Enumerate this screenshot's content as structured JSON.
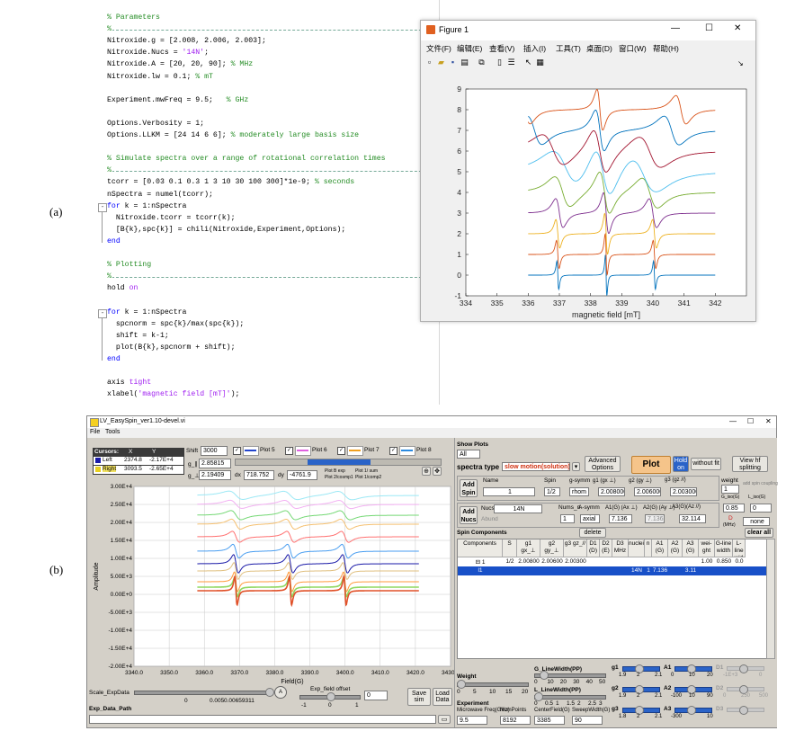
{
  "panel_labels": {
    "a": "(a)",
    "b": "(b)"
  },
  "code_lines": [
    {
      "text": "% Parameters",
      "style": "cm"
    },
    {
      "text": "%",
      "style": "sep"
    },
    {
      "text": "Nitroxide.g = [2.008, 2.006, 2.003];",
      "style": ""
    },
    {
      "text": "Nitroxide.Nucs = ",
      "str": "'14N'",
      "after": ";",
      "style": ""
    },
    {
      "text": "Nitroxide.A = [20, 20, 90];",
      "cmt": " % MHz",
      "style": ""
    },
    {
      "text": "Nitroxide.lw = 0.1;",
      "cmt": " % mT",
      "style": ""
    },
    {
      "text": "",
      "style": ""
    },
    {
      "text": "Experiment.mwFreq = 9.5;",
      "cmt": "   % GHz",
      "style": ""
    },
    {
      "text": "",
      "style": ""
    },
    {
      "text": "Options.Verbosity = 1;",
      "style": ""
    },
    {
      "text": "Options.LLKM = [24 14 6 6];",
      "cmt": " % moderately large basis size",
      "style": ""
    },
    {
      "text": "",
      "style": ""
    },
    {
      "text": "% Simulate spectra over a range of rotational correlation times",
      "style": "cm"
    },
    {
      "text": "%",
      "style": "sep"
    },
    {
      "text": "tcorr = [0.03 0.1 0.3 1 3 10 30 100 300]*1e-9;",
      "cmt": " % seconds",
      "style": ""
    },
    {
      "text": "nSpectra = numel(tcorr);",
      "style": ""
    },
    {
      "kw": "for",
      "text": " k = 1:nSpectra",
      "style": "",
      "fold": "-"
    },
    {
      "text": "  Nitroxide.tcorr = tcorr(k);",
      "style": ""
    },
    {
      "text": "  [B{k},spc{k}] = chili(Nitroxide,Experiment,Options);",
      "style": ""
    },
    {
      "kw": "end",
      "text": "",
      "style": ""
    },
    {
      "text": "",
      "style": ""
    },
    {
      "text": "% Plotting",
      "style": "cm"
    },
    {
      "text": "%",
      "style": "sep"
    },
    {
      "text": "hold ",
      "str": "on",
      "style": ""
    },
    {
      "text": "",
      "style": ""
    },
    {
      "kw": "for",
      "text": " k = 1:nSpectra",
      "style": "",
      "fold": "-"
    },
    {
      "text": "  spcnorm = spc{k}/max(spc{k});",
      "style": ""
    },
    {
      "text": "  shift = k-1;",
      "style": ""
    },
    {
      "text": "  plot(B{k},spcnorm + shift);",
      "style": ""
    },
    {
      "kw": "end",
      "text": "",
      "style": ""
    },
    {
      "text": "",
      "style": ""
    },
    {
      "text": "axis ",
      "str": "tight",
      "style": ""
    },
    {
      "text": "xlabel(",
      "str": "'magnetic field [mT]'",
      "after": ");",
      "style": ""
    }
  ],
  "figure_window": {
    "title": "Figure 1",
    "icon": "matlab-figure-icon",
    "controls": {
      "minimize": "—",
      "maximize": "☐",
      "close": "✕"
    },
    "menu": [
      "文件(F)",
      "编辑(E)",
      "查看(V)",
      "插入(I)",
      "工具(T)",
      "桌面(D)",
      "窗口(W)",
      "帮助(H)"
    ],
    "menu_arrow": "↘"
  },
  "chart_data": [
    {
      "type": "line",
      "title": "",
      "xlabel": "magnetic field [mT]",
      "ylabel": "",
      "xlim": [
        334,
        343
      ],
      "ylim": [
        -1,
        9
      ],
      "x_ticks": [
        334,
        335,
        336,
        337,
        338,
        339,
        340,
        341,
        342
      ],
      "y_ticks": [
        -1,
        0,
        1,
        2,
        3,
        4,
        5,
        6,
        7,
        8,
        9
      ],
      "grid": false,
      "legend": "none",
      "series": [
        {
          "offset": 0,
          "color": "#0072bd",
          "lines": [
            336.95,
            338.5,
            340.05
          ],
          "width": 0.05,
          "rot": 0.0
        },
        {
          "offset": 1,
          "color": "#d95319",
          "lines": [
            336.95,
            338.5,
            340.05
          ],
          "width": 0.07,
          "rot": 0.05
        },
        {
          "offset": 2,
          "color": "#edb120",
          "lines": [
            336.95,
            338.5,
            340.05
          ],
          "width": 0.1,
          "rot": 0.15
        },
        {
          "offset": 3,
          "color": "#7e2f8e",
          "lines": [
            337.0,
            338.5,
            340.0
          ],
          "width": 0.18,
          "rot": 0.35
        },
        {
          "offset": 4,
          "color": "#77ac30",
          "lines": [
            337.1,
            338.45,
            339.9
          ],
          "width": 0.35,
          "rot": 0.6
        },
        {
          "offset": 5,
          "color": "#4dbeee",
          "lines": [
            337.2,
            338.4,
            339.7
          ],
          "width": 0.55,
          "rot": 0.8
        },
        {
          "offset": 6,
          "color": "#a2142f",
          "lines": [
            336.8,
            338.3,
            339.9
          ],
          "width": 0.45,
          "rot": 0.9
        },
        {
          "offset": 7,
          "color": "#0072bd",
          "lines": [
            336.2,
            338.3,
            340.6
          ],
          "width": 0.3,
          "rot": 1.0
        },
        {
          "offset": 8,
          "color": "#d95319",
          "lines": [
            335.9,
            338.3,
            340.9
          ],
          "width": 0.2,
          "rot": 1.0
        }
      ]
    },
    {
      "type": "line",
      "title": "",
      "xlabel": "Field(G)",
      "ylabel": "Amplitude",
      "xlim": [
        3340,
        3430
      ],
      "ylim": [
        -20000,
        30000
      ],
      "x_ticks": [
        "3340.0",
        "3350.0",
        "3360.0",
        "3370.0",
        "3380.0",
        "3390.0",
        "3400.0",
        "3410.0",
        "3420.0",
        "3430.0"
      ],
      "y_ticks": [
        "3.00E+4",
        "2.50E+4",
        "2.00E+4",
        "1.50E+4",
        "1.00E+4",
        "5.00E+3",
        "0.00E+0",
        "-5.00E+3",
        "-1.00E+4",
        "-1.50E+4",
        "-2.00E+4"
      ],
      "grid": true,
      "legend": "none",
      "main_lines": [
        3369.0,
        3384.5,
        3400.0
      ],
      "series": [
        {
          "offset": 27500,
          "color": "#9be8f5",
          "amp": 800,
          "width": 3.5
        },
        {
          "offset": 25000,
          "color": "#f2b0f2",
          "amp": 900,
          "width": 3.0
        },
        {
          "offset": 22000,
          "color": "#74d874",
          "amp": 1200,
          "width": 2.5
        },
        {
          "offset": 19500,
          "color": "#f5c070",
          "amp": 1500,
          "width": 2.2
        },
        {
          "offset": 16000,
          "color": "#ff7070",
          "amp": 2000,
          "width": 1.8
        },
        {
          "offset": 12000,
          "color": "#4a9ef0",
          "amp": 3000,
          "width": 1.5
        },
        {
          "offset": 8500,
          "color": "#1a1aa8",
          "amp": 5000,
          "width": 1.2
        },
        {
          "offset": 6500,
          "color": "#e0c080",
          "amp": 5500,
          "width": 1.0
        },
        {
          "offset": 3500,
          "color": "#ff9a3a",
          "amp": 8000,
          "width": 0.8
        },
        {
          "offset": 2000,
          "color": "#8fd860",
          "amp": 9000,
          "width": 0.7
        },
        {
          "offset": 1000,
          "color": "#e05028",
          "amp": 17000,
          "width": 0.55
        }
      ]
    }
  ],
  "lv_app": {
    "title": "LV_EasySpin_ver1.10-devel.vi",
    "title_controls": {
      "minimize": "—",
      "maximize": "☐",
      "close": "✕"
    },
    "menu": [
      "File",
      "Tools"
    ],
    "cursors": {
      "header": [
        "Cursors:",
        "X",
        "Y"
      ],
      "rows": [
        {
          "name": "Left",
          "x": "2374.8",
          "y": "-2.17E+4",
          "swatch": "#1a1aa8"
        },
        {
          "name": "Right",
          "x": "3093.5",
          "y": "-2.65E+4",
          "swatch": "#e8d020"
        }
      ]
    },
    "shift": {
      "label": "Shift",
      "value": "3000"
    },
    "g_para": {
      "label": "g_∥",
      "value": "2.85815"
    },
    "g_perp": {
      "label": "g_⊥",
      "value": "2.19409"
    },
    "dx": {
      "label": "dx",
      "value": "718.752"
    },
    "dy": {
      "label": "dy",
      "value": "-4761.9"
    },
    "plot_notes": [
      "Plot B exp",
      "Plot 2/cosmp1",
      "Plot 1/ sum",
      "Plot 1/comp2"
    ],
    "plot_legend": [
      {
        "label": "Plot 5",
        "color": "#2244cc"
      },
      {
        "label": "Plot 6",
        "color": "#e060e0"
      },
      {
        "label": "Plot 7",
        "color": "#f0a020"
      },
      {
        "label": "Plot 8",
        "color": "#2a8ae0"
      }
    ],
    "show_plots": {
      "label": "Show Plots",
      "value": "All"
    },
    "spectra_type": {
      "label": "spectra type",
      "value": "slow motion(solution)"
    },
    "buttons": {
      "advanced": "Advanced Options",
      "plot": "Plot",
      "hold": "Hold on",
      "without_fit": "without fit",
      "view_hf": "View hf splitting",
      "add_spin": "Add Spin",
      "add_nucs": "Add Nucs",
      "delete": "delete",
      "clear_all": "clear all",
      "save_sim": "Save sim",
      "load_data": "Load Data"
    },
    "spin": {
      "headers": [
        "Name",
        "Spin",
        "g-symm",
        "g1 (gx ⊥)",
        "g2 (gy ⊥)",
        "g3 (gz //)",
        "weight"
      ],
      "name": "1",
      "spin": "1/2",
      "gsymm": "rhom",
      "g1": "2.008000",
      "g2": "2.006000",
      "g3": "2.003000",
      "weight": "1"
    },
    "nucs": {
      "headers": [
        "Nucs",
        "Nums_n",
        "A-symm",
        "A1(G) (Ax ⊥)",
        "A2(G) (Ay ⊥)",
        "A3(G)(Az //)"
      ],
      "nucs": "14N",
      "abund": "Abund",
      "nums": "1",
      "asymm": "axial",
      "a1": "7.136",
      "a2": "7.136",
      "a3": "32.114"
    },
    "side_small": {
      "add_spin_coupling": "add spin coupling",
      "g_iso": "G_iso(G)",
      "l_iso": "L_iso(G)",
      "g_val": "0.85",
      "l_val": "0",
      "d_label": "D",
      "d_sub": "(MHz)",
      "none": "none"
    },
    "spin_components": {
      "title": "Spin Components",
      "columns": [
        "Components",
        "S",
        "g1 gx_⊥",
        "g2 gy_⊥",
        "g3 gz_//",
        "D1 (D)",
        "D2 (E)",
        "D3 MHz",
        "nuclei",
        "n",
        "A1 (G)",
        "A2 (G)",
        "A3 (G)",
        "wei-ght",
        "G-line width",
        "L-line wid"
      ],
      "rows": [
        [
          "⊟ 1",
          "1/2",
          "2.00800",
          "2.00600",
          "2.00300",
          "",
          "",
          "",
          "",
          "",
          "",
          "",
          "",
          "1.00",
          "0.850",
          "0.0"
        ],
        [
          "l1",
          "",
          "",
          "",
          "",
          "",
          "",
          "",
          "14N",
          "1",
          "7.136",
          "",
          "3.11",
          "",
          "",
          ""
        ]
      ]
    },
    "sliders": {
      "weight": {
        "label": "Weight",
        "ticks": [
          "0",
          "5",
          "10",
          "15",
          "20"
        ]
      },
      "g_lw": {
        "label": "G_LineWidth(PP)",
        "ticks": [
          "0",
          "10",
          "20",
          "30",
          "40",
          "50"
        ]
      },
      "l_lw": {
        "label": "L_LineWidth(PP)",
        "ticks": [
          "0",
          "0.5",
          "1",
          "1.5",
          "2",
          "2.5",
          "3"
        ]
      },
      "g1": {
        "label": "g1",
        "ticks": [
          "1.9",
          "2",
          "2.1"
        ]
      },
      "g2": {
        "label": "g2",
        "ticks": [
          "1.9",
          "2",
          "2.1"
        ]
      },
      "g3": {
        "label": "g3",
        "ticks": [
          "1.8",
          "2",
          "2.1"
        ]
      },
      "a1": {
        "label": "A1",
        "ticks": [
          "0",
          "10",
          "20"
        ]
      },
      "a2": {
        "label": "A2",
        "ticks": [
          "-100",
          "10",
          "90"
        ]
      },
      "a3": {
        "label": "A3",
        "ticks": [
          "-300",
          "10"
        ]
      },
      "d1": {
        "label": "D1",
        "ticks": [
          "-1E+3",
          "0"
        ]
      },
      "d2": {
        "label": "D2",
        "ticks": [
          "0",
          "250",
          "500"
        ]
      },
      "d3": {
        "label": "D3",
        "ticks": [
          ""
        ]
      }
    },
    "experiment": {
      "label": "Experiment",
      "fields": [
        {
          "label": "Microwave Freq(GHz)",
          "value": "9.5"
        },
        {
          "label": "NumPoints",
          "value": "8192"
        },
        {
          "label": "CenterField(G)",
          "value": "3385"
        },
        {
          "label": "SweepWidth(G)",
          "value": "90"
        }
      ]
    },
    "scale_expdata": {
      "label": "Scale_ExpData",
      "ticks": [
        "0",
        "0.005",
        "0.00659311"
      ]
    },
    "exp_field_offset": {
      "label": "Exp_field offset",
      "value": "0",
      "ticks": [
        "-1",
        "0",
        "1"
      ]
    },
    "exp_data_path": {
      "label": "Exp_Data_Path",
      "value": ""
    }
  }
}
